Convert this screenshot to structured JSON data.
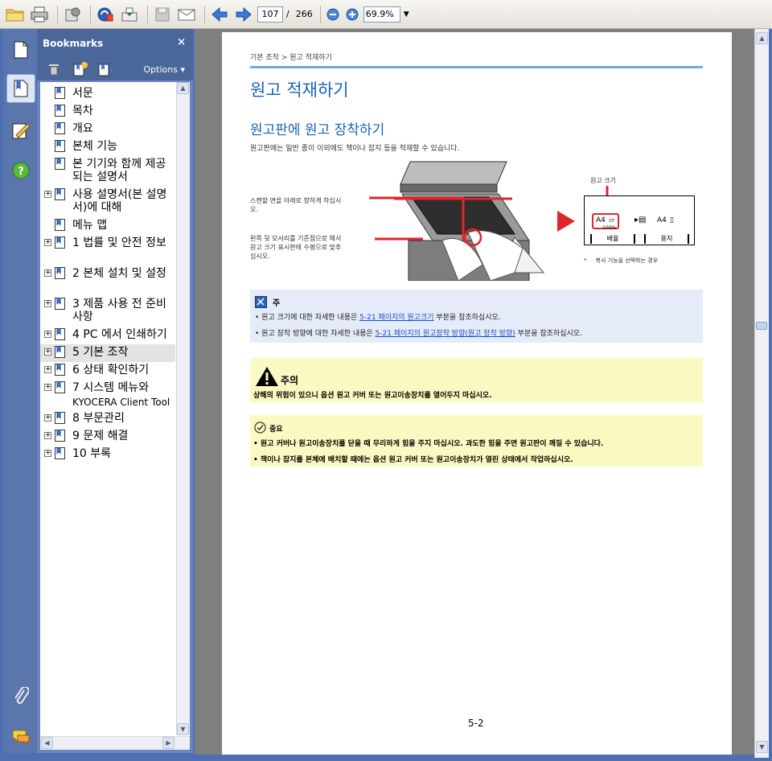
{
  "toolbar": {
    "current_page": "107",
    "page_separator": "/",
    "total_pages": "266",
    "zoom": "69.9%"
  },
  "bookmarks": {
    "title": "Bookmarks",
    "close": "×",
    "options": "Options",
    "items": [
      {
        "label": "서문",
        "expandable": false
      },
      {
        "label": "목차",
        "expandable": false
      },
      {
        "label": "개요",
        "expandable": false
      },
      {
        "label": "본체 기능",
        "expandable": false
      },
      {
        "label": "본 기기와 함께 제공되는 설명서",
        "expandable": false
      },
      {
        "label": "사용 설명서(본 설명서)에 대해",
        "expandable": true
      },
      {
        "label": "메뉴 맵",
        "expandable": false
      },
      {
        "label": "1 법률 및 안전 정보",
        "expandable": true
      },
      {
        "label": "2 본체 설치 및 설정",
        "expandable": true
      },
      {
        "label": "3 제품 사용 전 준비사항",
        "expandable": true
      },
      {
        "label": "4 PC 에서 인쇄하기",
        "expandable": true
      },
      {
        "label": "5 기본 조작",
        "expandable": true,
        "selected": true
      },
      {
        "label": "6 상태 확인하기",
        "expandable": true
      },
      {
        "label": "7 시스템 메뉴와",
        "sub": "KYOCERA Client Tool",
        "expandable": true
      },
      {
        "label": "8 부문관리",
        "expandable": true
      },
      {
        "label": "9 문제 해결",
        "expandable": true
      },
      {
        "label": "10 부록",
        "expandable": true
      }
    ]
  },
  "doc": {
    "breadcrumb": "기본 조작 > 원고 적재하기",
    "h1": "원고 적재하기",
    "h2": "원고판에 원고 장착하기",
    "intro": "원고판에는 일반 종이 이외에도 책이나 잡지 등을 적재할 수 있습니다.",
    "callout1_line1": "스캔할 면을 아래로 향하게 하십시",
    "callout1_line2": "오.",
    "callout2_line1": "왼쪽 뒷 모서리를 기준점으로 해서",
    "callout2_line2": "원고 크기 표시판에 수평으로 맞추",
    "callout2_line3": "십시오.",
    "panel_title": "원고 크기",
    "panel_a4_left": "A4",
    "panel_a4_right": "A4",
    "panel_pct": "100%",
    "panel_btn1": "배율",
    "panel_btn2": "용지",
    "footnote_mark": "*",
    "footnote": "복사 기능을 선택하는 경우",
    "note_title": "주",
    "note1_pre": "• 원고 크기에 대한 자세한 내용은 ",
    "note1_link": "5-21 페이지의 원고크기",
    "note1_post": " 부분을 참조하십시오.",
    "note2_pre": "• 원고 장착 방향에 대한 자세한 내용은 ",
    "note2_link": "5-21 페이지의 원고장착 방향(원고 장착 방향)",
    "note2_post": " 부분을 참조하십시오.",
    "caution_title": "주의",
    "caution_text": "상해의 위험이 있으니 옵션 원고 커버 또는 원고이송장치를 열어두지 마십시오.",
    "important_title": "중요",
    "important1": "• 원고 커버나 원고이송장치를 닫을 때 무리하게 힘을 주지 마십시오. 과도한 힘을 주면 원고판이 깨질 수 있습니다.",
    "important2": "• 책이나 잡지를 본체에 배치할 때에는 옵션 원고 커버 또는 원고이송장치가 열린 상태에서 작업하십시오.",
    "page_number": "5-2"
  },
  "colors": {
    "heading_blue": "#1a63b5",
    "link_blue": "#1a4fcc",
    "note_bg": "#e5ebf8",
    "caution_bg": "#fbf9c2",
    "callout_red": "#e0262d"
  },
  "icons": [
    "open-folder-icon",
    "print-icon",
    "settings-icon",
    "create-pdf-icon",
    "upload-icon",
    "save-icon",
    "email-icon",
    "prev-page-icon",
    "next-page-icon",
    "zoom-out-icon",
    "zoom-in-icon",
    "pages-icon",
    "bookmarks-icon",
    "signatures-icon",
    "help-icon",
    "attachments-icon",
    "comments-icon",
    "delete-icon",
    "new-bookmark-icon",
    "expand-bookmark-icon"
  ]
}
